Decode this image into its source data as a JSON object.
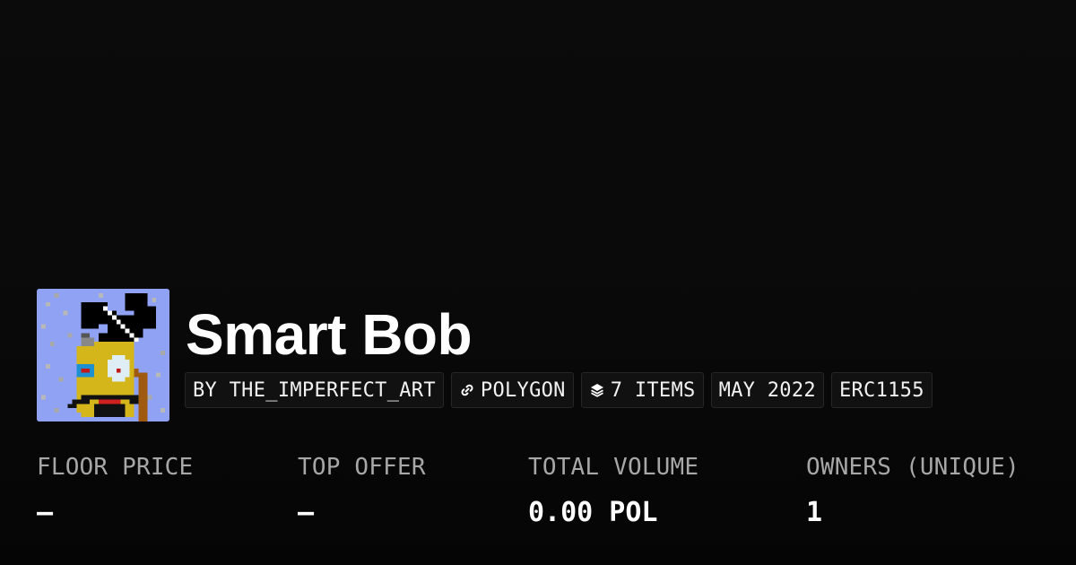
{
  "collection": {
    "name": "Smart Bob",
    "avatar_icon": "pixel-art-character-with-top-hat"
  },
  "tags": {
    "creator": "BY THE_IMPERFECT_ART",
    "chain": "POLYGON",
    "chain_icon": "chain-link-icon",
    "items": "7 ITEMS",
    "items_icon": "layers-icon",
    "date": "MAY 2022",
    "standard": "ERC1155"
  },
  "stats": {
    "floor_price": {
      "label": "FLOOR PRICE",
      "value": "–"
    },
    "top_offer": {
      "label": "TOP OFFER",
      "value": "–"
    },
    "total_volume": {
      "label": "TOTAL VOLUME",
      "value": "0.00 POL"
    },
    "owners": {
      "label": "OWNERS (UNIQUE)",
      "value": "1"
    }
  },
  "colors": {
    "background": "#0a0a0a",
    "avatar_bg": "#8fa2f4",
    "label": "#a7a7a7"
  }
}
